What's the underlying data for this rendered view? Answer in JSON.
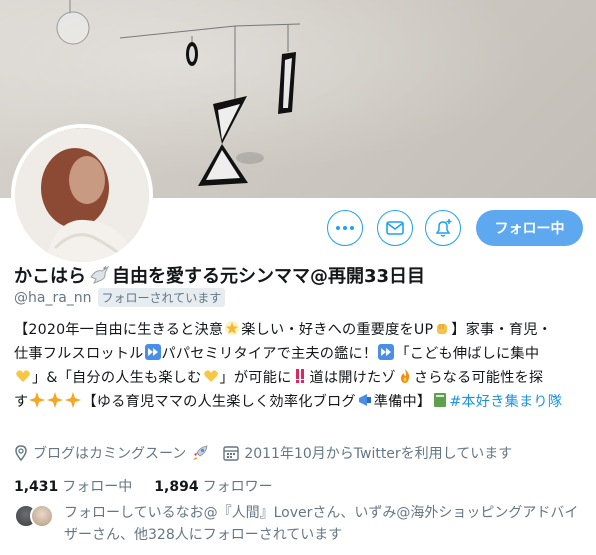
{
  "profile": {
    "display_name": "かこはら",
    "display_name_rest": "自由を愛する元シンママ@再開33日目",
    "handle": "@ha_ra_nn",
    "follows_you": "フォローされています"
  },
  "actions": {
    "follow_label": "フォロー中",
    "more_icon": "more-icon",
    "dm_icon": "mail-icon",
    "notify_icon": "bell-plus-icon"
  },
  "bio": {
    "line1_a": "【2020年一自由に生きると決意",
    "line1_b": "楽しい・好きへの重要度をUP",
    "line1_c": "】家事・育児・",
    "line2_a": "仕事フルスロットル",
    "line2_b": "パパセミリタイアで主夫の鑑に！",
    "line2_c": "「こども伸ばしに集中",
    "line3_a": "」&「自分の人生も楽しむ",
    "line3_b": "」が可能に",
    "line3_c": "道は開けたゾ",
    "line3_d": "さらなる可能性を探",
    "line4_a": "す",
    "line4_b": "【ゆる育児ママの人生楽しく効率化ブログ",
    "line4_c": "準備中】",
    "hashtag": "#本好き集まり隊"
  },
  "meta": {
    "location": "ブログはカミングスーン",
    "joined": "2011年10月からTwitterを利用しています"
  },
  "counts": {
    "following_num": "1,431",
    "following_label": "フォロー中",
    "followers_num": "1,894",
    "followers_label": "フォロワー"
  },
  "known_followers": {
    "text": "フォローしているなお@『人間』Loverさん、いずみ@海外ショッピングアドバイザーさん、他328人にフォローされています"
  },
  "colors": {
    "accent": "#1da1f2",
    "follow_bg": "#5ea8f0",
    "secondary_text": "#657786",
    "link": "#1b95e0"
  }
}
